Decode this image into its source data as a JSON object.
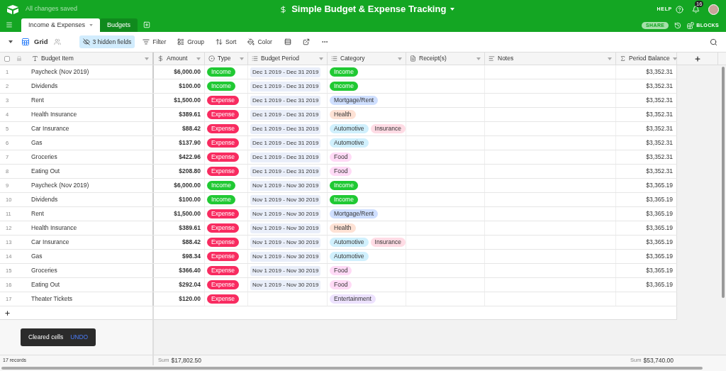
{
  "top_bar": {
    "status": "All changes saved",
    "title": "Simple Budget & Expense Tracking",
    "help": "HELP",
    "notification_count": "16"
  },
  "tabs": [
    {
      "label": "Income & Expenses",
      "selected": true
    },
    {
      "label": "Budgets",
      "selected": false
    }
  ],
  "actions": {
    "share": "SHARE",
    "blocks": "BLOCKS"
  },
  "toolbar": {
    "view": "Grid",
    "items": [
      {
        "label": "3 hidden fields",
        "kind": "hidden",
        "selected": true
      },
      {
        "label": "Filter",
        "kind": "filter",
        "selected": false
      },
      {
        "label": "Group",
        "kind": "group",
        "selected": false
      },
      {
        "label": "Sort",
        "kind": "sort",
        "selected": false
      },
      {
        "label": "Color",
        "kind": "color",
        "selected": false
      }
    ]
  },
  "table": {
    "select_all": {
      "checked": false
    },
    "columns": [
      {
        "label": "Budget Item",
        "kind": "text"
      },
      {
        "label": "Amount",
        "kind": "currency"
      },
      {
        "label": "Type",
        "kind": "select"
      },
      {
        "label": "Budget Period",
        "kind": "link"
      },
      {
        "label": "Category",
        "kind": "multi"
      },
      {
        "label": "Receipt(s)",
        "kind": "attachment"
      },
      {
        "label": "Notes",
        "kind": "longtext"
      },
      {
        "label": "Period Balance",
        "kind": "rollup"
      }
    ],
    "rows": [
      {
        "number": "1",
        "item": "Paycheck (Nov 2019)",
        "amount": "$6,000.00",
        "type": {
          "label": "Income",
          "color": "#20c933"
        },
        "period": "Dec 1 2019 - Dec 31 2019",
        "categories": [
          {
            "label": "Income",
            "color": "#20c933"
          }
        ],
        "balance": "$3,352.31"
      },
      {
        "number": "2",
        "item": "Dividends",
        "amount": "$100.00",
        "type": {
          "label": "Income",
          "color": "#20c933"
        },
        "period": "Dec 1 2019 - Dec 31 2019",
        "categories": [
          {
            "label": "Income",
            "color": "#20c933"
          }
        ],
        "balance": "$3,352.31"
      },
      {
        "number": "3",
        "item": "Rent",
        "amount": "$1,500.00",
        "type": {
          "label": "Expense",
          "color": "#f82b60"
        },
        "period": "Dec 1 2019 - Dec 31 2019",
        "categories": [
          {
            "label": "Mortgage/Rent",
            "color": "#cfdfff"
          }
        ],
        "balance": "$3,352.31"
      },
      {
        "number": "4",
        "item": "Health Insurance",
        "amount": "$389.61",
        "type": {
          "label": "Expense",
          "color": "#f82b60"
        },
        "period": "Dec 1 2019 - Dec 31 2019",
        "categories": [
          {
            "label": "Health",
            "color": "#fee2d5"
          }
        ],
        "balance": "$3,352.31"
      },
      {
        "number": "5",
        "item": "Car Insurance",
        "amount": "$88.42",
        "type": {
          "label": "Expense",
          "color": "#f82b60"
        },
        "period": "Dec 1 2019 - Dec 31 2019",
        "categories": [
          {
            "label": "Automotive",
            "color": "#d0f0fd"
          },
          {
            "label": "Insurance",
            "color": "#ffdce5"
          }
        ],
        "balance": "$3,352.31"
      },
      {
        "number": "6",
        "item": "Gas",
        "amount": "$137.90",
        "type": {
          "label": "Expense",
          "color": "#f82b60"
        },
        "period": "Dec 1 2019 - Dec 31 2019",
        "categories": [
          {
            "label": "Automotive",
            "color": "#d0f0fd"
          }
        ],
        "balance": "$3,352.31"
      },
      {
        "number": "7",
        "item": "Groceries",
        "amount": "$422.96",
        "type": {
          "label": "Expense",
          "color": "#f82b60"
        },
        "period": "Dec 1 2019 - Dec 31 2019",
        "categories": [
          {
            "label": "Food",
            "color": "#ffdaf6"
          }
        ],
        "balance": "$3,352.31"
      },
      {
        "number": "8",
        "item": "Eating Out",
        "amount": "$208.80",
        "type": {
          "label": "Expense",
          "color": "#f82b60"
        },
        "period": "Dec 1 2019 - Dec 31 2019",
        "categories": [
          {
            "label": "Food",
            "color": "#ffdaf6"
          }
        ],
        "balance": "$3,352.31"
      },
      {
        "number": "9",
        "item": "Paycheck (Nov 2019)",
        "amount": "$6,000.00",
        "type": {
          "label": "Income",
          "color": "#20c933"
        },
        "period": "Nov 1 2019 - Nov 30 2019",
        "categories": [
          {
            "label": "Income",
            "color": "#20c933"
          }
        ],
        "balance": "$3,365.19"
      },
      {
        "number": "10",
        "item": "Dividends",
        "amount": "$100.00",
        "type": {
          "label": "Income",
          "color": "#20c933"
        },
        "period": "Nov 1 2019 - Nov 30 2019",
        "categories": [
          {
            "label": "Income",
            "color": "#20c933"
          }
        ],
        "balance": "$3,365.19"
      },
      {
        "number": "11",
        "item": "Rent",
        "amount": "$1,500.00",
        "type": {
          "label": "Expense",
          "color": "#f82b60"
        },
        "period": "Nov 1 2019 - Nov 30 2019",
        "categories": [
          {
            "label": "Mortgage/Rent",
            "color": "#cfdfff"
          }
        ],
        "balance": "$3,365.19"
      },
      {
        "number": "12",
        "item": "Health Insurance",
        "amount": "$389.61",
        "type": {
          "label": "Expense",
          "color": "#f82b60"
        },
        "period": "Nov 1 2019 - Nov 30 2019",
        "categories": [
          {
            "label": "Health",
            "color": "#fee2d5"
          }
        ],
        "balance": "$3,365.19"
      },
      {
        "number": "13",
        "item": "Car Insurance",
        "amount": "$88.42",
        "type": {
          "label": "Expense",
          "color": "#f82b60"
        },
        "period": "Nov 1 2019 - Nov 30 2019",
        "categories": [
          {
            "label": "Automotive",
            "color": "#d0f0fd"
          },
          {
            "label": "Insurance",
            "color": "#ffdce5"
          }
        ],
        "balance": "$3,365.19"
      },
      {
        "number": "14",
        "item": "Gas",
        "amount": "$98.34",
        "type": {
          "label": "Expense",
          "color": "#f82b60"
        },
        "period": "Nov 1 2019 - Nov 30 2019",
        "categories": [
          {
            "label": "Automotive",
            "color": "#d0f0fd"
          }
        ],
        "balance": "$3,365.19"
      },
      {
        "number": "15",
        "item": "Groceries",
        "amount": "$366.40",
        "type": {
          "label": "Expense",
          "color": "#f82b60"
        },
        "period": "Nov 1 2019 - Nov 30 2019",
        "categories": [
          {
            "label": "Food",
            "color": "#ffdaf6"
          }
        ],
        "balance": "$3,365.19"
      },
      {
        "number": "16",
        "item": "Eating Out",
        "amount": "$292.04",
        "type": {
          "label": "Expense",
          "color": "#f82b60"
        },
        "period": "Nov 1 2019 - Nov 30 2019",
        "categories": [
          {
            "label": "Food",
            "color": "#ffdaf6"
          }
        ],
        "balance": "$3,365.19"
      },
      {
        "number": "17",
        "item": "Theater Tickets",
        "amount": "$120.00",
        "type": {
          "label": "Expense",
          "color": "#f82b60"
        },
        "categories": [
          {
            "label": "Entertainment",
            "color": "#ede2fe"
          }
        ]
      }
    ]
  },
  "toast": {
    "message": "Cleared cells",
    "action": "UNDO"
  },
  "footer": {
    "records": "17 records",
    "amount_sum_label": "Sum",
    "amount_sum": "$17,802.50",
    "balance_sum_label": "Sum",
    "balance_sum": "$53,740.00"
  }
}
